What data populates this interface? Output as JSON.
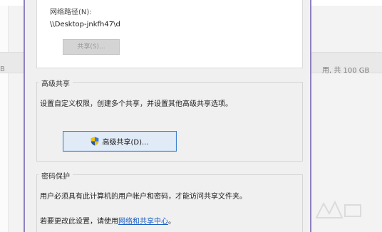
{
  "background": {
    "left_fragment": "B",
    "right_fragment": "用, 共 100 GB"
  },
  "network_path": {
    "label": "网络路径(N):",
    "value": "\\\\Desktop-jnkfh47\\d",
    "share_button": "共享(S)..."
  },
  "advanced_sharing": {
    "title": "高级共享",
    "description": "设置自定义权限，创建多个共享，并设置其他高级共享选项。",
    "button": "高级共享(D)..."
  },
  "password_protection": {
    "title": "密码保护",
    "line1": "用户必须具有此计算机的用户帐户和密码，才能访问共享文件夹。",
    "line2_prefix": "若要更改此设置，请使用",
    "link": "网络和共享中心",
    "line2_suffix": "。"
  },
  "icons": {
    "shield": "uac-shield-icon"
  },
  "colors": {
    "dialog_border": "#8f7fbf",
    "button_focus_border": "#3c7fd0",
    "link": "#1a5fc4"
  }
}
